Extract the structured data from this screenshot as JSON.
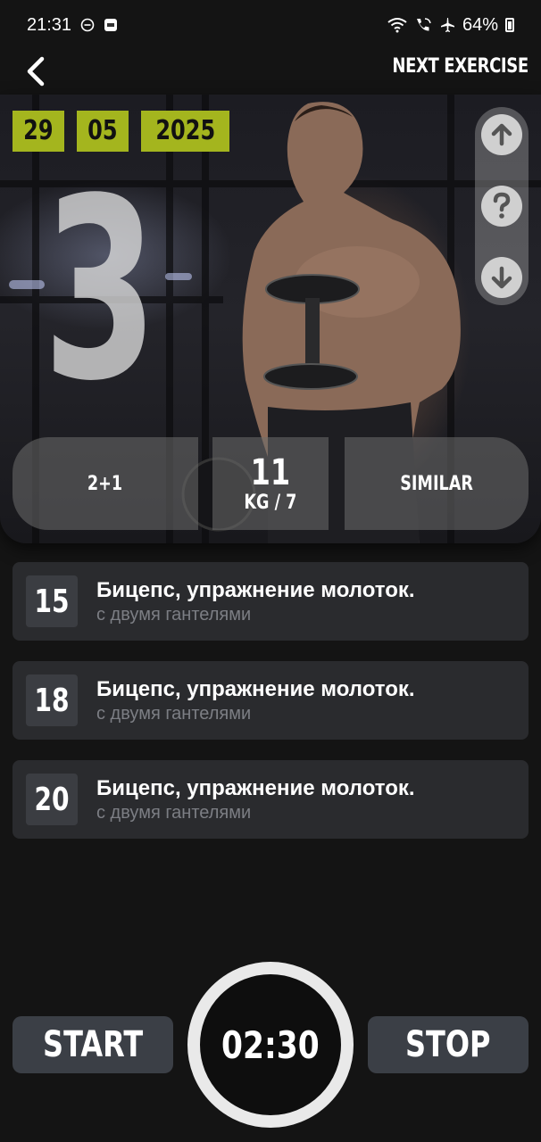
{
  "status_bar": {
    "time": "21:31",
    "battery": "64%",
    "icons": [
      "do-not-disturb-icon",
      "weather-app-icon",
      "wifi-icon",
      "wifi-calling-icon",
      "airplane-mode-icon",
      "battery-icon"
    ]
  },
  "header": {
    "next_exercise_label": "NEXT EXERCISE"
  },
  "date": {
    "day": "29",
    "month": "05",
    "year": "2025"
  },
  "set_number": "3",
  "stats": {
    "left_label": "2+1",
    "weight_value": "11",
    "weight_unit": "KG / 7",
    "right_label": "SIMILAR"
  },
  "exercises": [
    {
      "reps": "15",
      "title": "Бицепс, упражнение молоток.",
      "subtitle": "с двумя гантелями"
    },
    {
      "reps": "18",
      "title": "Бицепс, упражнение молоток.",
      "subtitle": "с двумя гантелями"
    },
    {
      "reps": "20",
      "title": "Бицепс, упражнение молоток.",
      "subtitle": "с двумя гантелями"
    }
  ],
  "controls": {
    "start_label": "START",
    "stop_label": "STOP",
    "timer": "02:30"
  },
  "colors": {
    "background": "#141414",
    "accent_lime": "#a4b51e",
    "card": "#2a2b2e",
    "button": "#3b3f46"
  }
}
